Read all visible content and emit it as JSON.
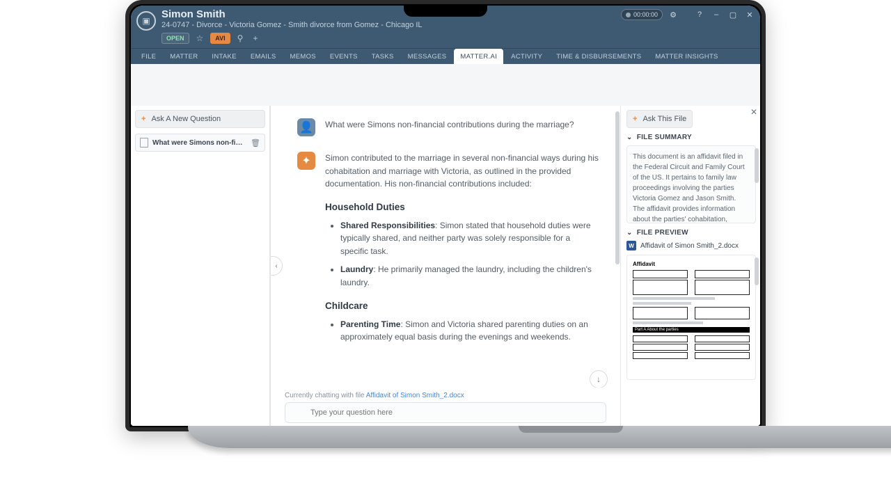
{
  "header": {
    "client_name": "Simon Smith",
    "matter_line": "24-0747 - Divorce - Victoria Gomez - Smith divorce from Gomez - Chicago IL",
    "status_badge": "OPEN",
    "avi_badge": "AVI",
    "timer": "00:00:00"
  },
  "tabs": [
    "FILE",
    "MATTER",
    "INTAKE",
    "EMAILS",
    "MEMOS",
    "EVENTS",
    "TASKS",
    "MESSAGES",
    "MATTER.AI",
    "ACTIVITY",
    "TIME & DISBURSEMENTS",
    "MATTER INSIGHTS"
  ],
  "active_tab_index": 8,
  "left": {
    "ask_button": "Ask A New Question",
    "question_preview": "What were Simons non-financial con…"
  },
  "chat": {
    "user_question": "What were Simons non-financial contributions during the marriage?",
    "ai_intro": "Simon contributed to the marriage in several non-financial ways during his cohabitation and marriage with Victoria, as outlined in the provided documentation. His non-financial contributions included:",
    "h1": "Household Duties",
    "b1a_label": "Shared Responsibilities",
    "b1a_text": ": Simon stated that household duties were typically shared, and neither party was solely responsible for a specific task.",
    "b1b_label": "Laundry",
    "b1b_text": ": He primarily managed the laundry, including the children's laundry.",
    "h2": "Childcare",
    "b2a_label": "Parenting Time",
    "b2a_text": ": Simon and Victoria shared parenting duties on an approximately equal basis during the evenings and weekends.",
    "context_prefix": "Currently chatting with file ",
    "context_file": "Affidavit of Simon Smith_2.docx",
    "input_placeholder": "Type your question here"
  },
  "right": {
    "ask_file_button": "Ask This File",
    "summary_title": "FILE SUMMARY",
    "summary_text": "This document is an affidavit filed in the Federal Circuit and Family Court of the US. It pertains to family law proceedings involving the parties Victoria Gomez and Jason Smith. The affidavit provides information about the parties' cohabitation, financial contributions, and separation. It also mentions the two children of the",
    "preview_title": "FILE PREVIEW",
    "file_name": "Affidavit of Simon Smith_2.docx",
    "doc_heading": "Affidavit",
    "part_a": "Part A   About the parties"
  }
}
